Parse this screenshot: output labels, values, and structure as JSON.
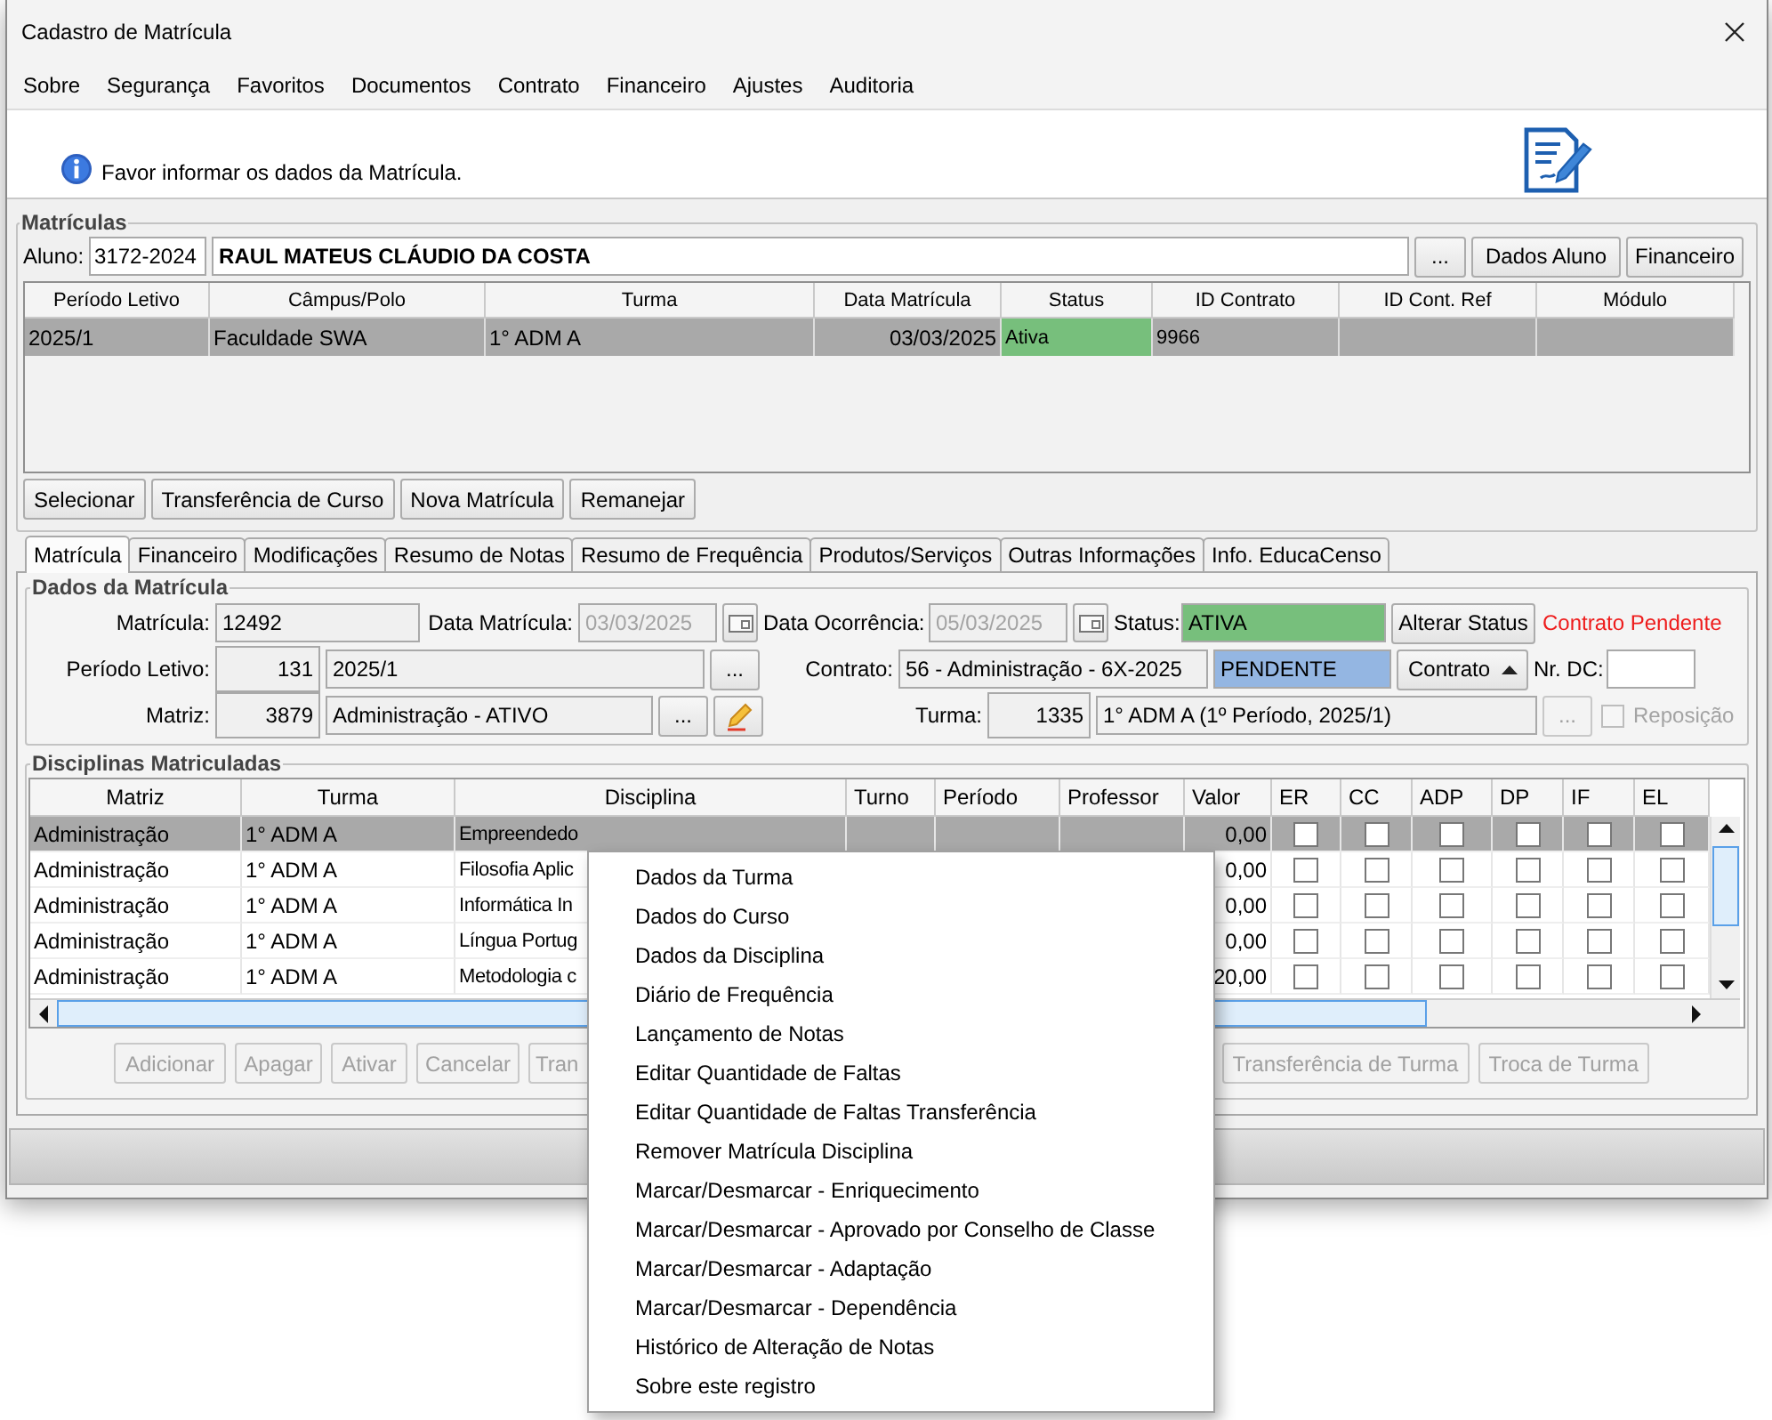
{
  "window": {
    "title": "Cadastro de Matrícula"
  },
  "menu": [
    "Sobre",
    "Segurança",
    "Favoritos",
    "Documentos",
    "Contrato",
    "Financeiro",
    "Ajustes",
    "Auditoria"
  ],
  "info": {
    "text": "Favor informar os dados da Matrícula."
  },
  "matriculas": {
    "title": "Matrículas",
    "aluno_label": "Aluno:",
    "aluno_code": "3172-2024",
    "aluno_name": "RAUL MATEUS CLÁUDIO DA COSTA",
    "aluno_buttons": [
      "...",
      "Dados Aluno",
      "Financeiro"
    ],
    "columns": [
      "Período Letivo",
      "Câmpus/Polo",
      "Turma",
      "Data Matrícula",
      "Status",
      "ID Contrato",
      "ID Cont. Ref",
      "Módulo"
    ],
    "rows": [
      {
        "cells": [
          "2025/1",
          "Faculdade SWA",
          "1° ADM A",
          "03/03/2025",
          {
            "text": "Ativa",
            "color": "#77bf7c"
          },
          "9966"
        ],
        "selected": true
      }
    ],
    "actions": [
      "Selecionar",
      "Transferência de Curso",
      "Nova Matrícula",
      "Remanejar"
    ]
  },
  "tabs": [
    {
      "label": "Matrícula",
      "selected": true
    },
    {
      "label": "Financeiro",
      "selected": false
    },
    {
      "label": "Modificações",
      "selected": false
    },
    {
      "label": "Resumo de Notas",
      "selected": false
    },
    {
      "label": "Resumo de Frequência",
      "selected": false
    },
    {
      "label": "Produtos/Serviços",
      "selected": false
    },
    {
      "label": "Outras Informações",
      "selected": false
    },
    {
      "label": "Info. EducaCenso",
      "selected": false
    }
  ],
  "dados": {
    "title": "Dados da Matrícula",
    "matricula": {
      "label": "Matrícula:",
      "value": "12492"
    },
    "data_matricula": {
      "label": "Data Matrícula:",
      "value": "03/03/2025",
      "disabled": true
    },
    "data_ocorrencia": {
      "label": "Data Ocorrência:",
      "value": "05/03/2025",
      "disabled": true
    },
    "status": {
      "label": "Status:",
      "value": "ATIVA",
      "color": "#77bf7c"
    },
    "alterar_status": "Alterar Status",
    "warning": "Contrato Pendente",
    "periodo": {
      "label": "Período Letivo:",
      "code": "131",
      "value": "2025/1",
      "browse": "..."
    },
    "contrato": {
      "label": "Contrato:",
      "value": "56 - Administração - 6X-2025",
      "state": {
        "text": "PENDENTE",
        "color": "#94b6e2"
      },
      "button": "Contrato"
    },
    "nr_dc": {
      "label": "Nr. DC:"
    },
    "matriz": {
      "label": "Matriz:",
      "code": "3879",
      "value": "Administração - ATIVO",
      "browse": "..."
    },
    "turma": {
      "label": "Turma:",
      "code": "1335",
      "value": "1° ADM A (1º Período, 2025/1)",
      "browse": "..."
    },
    "reposicao": {
      "label": "Reposição",
      "checked": false,
      "disabled": true
    }
  },
  "disciplinas": {
    "title": "Disciplinas Matriculadas",
    "columns": [
      "Matriz",
      "Turma",
      "Disciplina",
      "Turno",
      "Período",
      "Professor",
      "Valor",
      "ER",
      "CC",
      "ADP",
      "DP",
      "IF",
      "EL"
    ],
    "rows": [
      {
        "matriz": "Administração",
        "turma": "1° ADM A",
        "disciplina": "Empreendedo",
        "valor": "0,00",
        "flags": [
          false,
          false,
          false,
          false,
          false,
          false
        ],
        "selected": true
      },
      {
        "matriz": "Administração",
        "turma": "1° ADM A",
        "disciplina": "Filosofia Aplic",
        "valor": "0,00",
        "flags": [
          false,
          false,
          false,
          false,
          false,
          false
        ],
        "selected": false
      },
      {
        "matriz": "Administração",
        "turma": "1° ADM A",
        "disciplina": "Informática In",
        "valor": "0,00",
        "flags": [
          false,
          false,
          false,
          false,
          false,
          false
        ],
        "selected": false
      },
      {
        "matriz": "Administração",
        "turma": "1° ADM A",
        "disciplina": "Língua Portug",
        "valor": "0,00",
        "flags": [
          false,
          false,
          false,
          false,
          false,
          false
        ],
        "selected": false
      },
      {
        "matriz": "Administração",
        "turma": "1° ADM A",
        "disciplina": "Metodologia c",
        "valor": "20,00",
        "flags": [
          false,
          false,
          false,
          false,
          false,
          false
        ],
        "selected": false
      }
    ],
    "buttons_left": [
      {
        "label": "Adicionar",
        "disabled": true
      },
      {
        "label": "Apagar",
        "disabled": true
      },
      {
        "label": "Ativar",
        "disabled": true
      },
      {
        "label": "Cancelar",
        "disabled": true
      },
      {
        "label": "Tran",
        "disabled": true
      }
    ],
    "buttons_right": [
      {
        "label": "Transferência de Turma",
        "disabled": true
      },
      {
        "label": "Troca de Turma",
        "disabled": true
      }
    ]
  },
  "context_menu": [
    "Dados da Turma",
    "Dados do Curso",
    "Dados da Disciplina",
    "Diário de Frequência",
    "Lançamento de Notas",
    "Editar Quantidade de Faltas",
    "Editar Quantidade de Faltas Transferência",
    "Remover Matrícula Disciplina",
    "Marcar/Desmarcar - Enriquecimento",
    "Marcar/Desmarcar - Aprovado por Conselho de Classe",
    "Marcar/Desmarcar - Adaptação",
    "Marcar/Desmarcar - Dependência",
    "Histórico de Alteração de Notas",
    "Sobre este registro"
  ]
}
